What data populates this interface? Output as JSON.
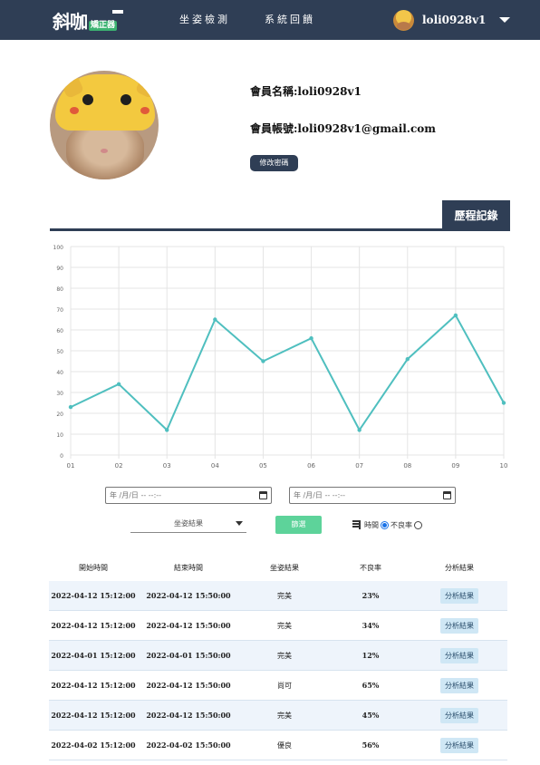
{
  "nav": {
    "logo_main": "斜咖",
    "logo_sub": "矯正器",
    "links": [
      "坐姿檢測",
      "系統回饋"
    ],
    "username": "loli0928v1"
  },
  "profile": {
    "name_label": "會員名稱:loli0928v1",
    "account_label": "會員帳號:loli0928v1@gmail.com",
    "change_password": "修改密碼"
  },
  "history_tab": "歷程記錄",
  "chart_data": {
    "type": "line",
    "categories": [
      "01",
      "02",
      "03",
      "04",
      "05",
      "06",
      "07",
      "08",
      "09",
      "10"
    ],
    "values": [
      23,
      34,
      12,
      65,
      45,
      56,
      12,
      46,
      67,
      25
    ],
    "ylim": [
      0,
      100
    ],
    "yticks": [
      0,
      10,
      20,
      30,
      40,
      50,
      60,
      70,
      80,
      90,
      100
    ],
    "line_color": "#4fbfbf",
    "grid": true
  },
  "filters": {
    "date_placeholder": "年 /月/日 -- --:--",
    "result_select": "坐姿結果",
    "filter_button": "篩選",
    "sort_time": "時間",
    "sort_rate": "不良率"
  },
  "table": {
    "headers": [
      "開始時間",
      "結束時間",
      "坐姿結果",
      "不良率",
      "分析結果"
    ],
    "rows": [
      [
        "2022-04-12 15:12:00",
        "2022-04-12 15:50:00",
        "完美",
        "23%",
        "分析結果"
      ],
      [
        "2022-04-12 15:12:00",
        "2022-04-12 15:50:00",
        "完美",
        "34%",
        "分析結果"
      ],
      [
        "2022-04-01 15:12:00",
        "2022-04-01 15:50:00",
        "完美",
        "12%",
        "分析結果"
      ],
      [
        "2022-04-12 15:12:00",
        "2022-04-12 15:50:00",
        "尚可",
        "65%",
        "分析結果"
      ],
      [
        "2022-04-12 15:12:00",
        "2022-04-12 15:50:00",
        "完美",
        "45%",
        "分析結果"
      ],
      [
        "2022-04-02 15:12:00",
        "2022-04-02 15:50:00",
        "優良",
        "56%",
        "分析結果"
      ]
    ]
  },
  "colors": {
    "nav_bg": "#2f3e55",
    "filter_button": "#5dd39a",
    "row_alt": "#eef4fb"
  }
}
